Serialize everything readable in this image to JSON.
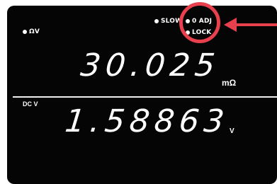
{
  "display": {
    "primary": {
      "mode_label": "ΩV",
      "value": "30.025",
      "unit": "mΩ"
    },
    "secondary": {
      "mode_label": "DC V",
      "value": "1.58863",
      "unit": "V"
    },
    "indicators": {
      "slow": "SLOW",
      "zero_adj": "0 ADJ",
      "lock": "LOCK"
    }
  },
  "annotation": {
    "highlight_color": "#e8414d"
  }
}
